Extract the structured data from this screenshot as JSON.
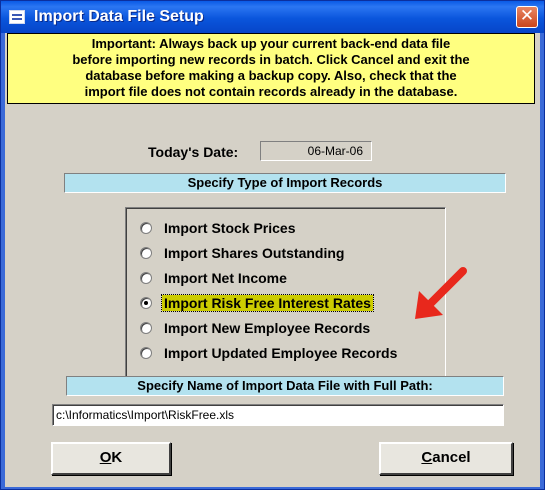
{
  "window": {
    "title": "Import Data File Setup",
    "close_glyph": "✕"
  },
  "warning": {
    "lines": [
      "Important: Always back up your current back-end data file",
      "before importing new records in batch. Click Cancel and exit the",
      "database before making a backup copy. Also, check that the",
      "import file does not contain records already in the database."
    ]
  },
  "date": {
    "label": "Today's Date:",
    "value": "06-Mar-06"
  },
  "import_type": {
    "header": "Specify Type of Import Records",
    "options": [
      {
        "label": "Import Stock Prices",
        "checked": false
      },
      {
        "label": "Import Shares Outstanding",
        "checked": false
      },
      {
        "label": "Import Net Income",
        "checked": false
      },
      {
        "label": "Import Risk Free Interest Rates",
        "checked": true
      },
      {
        "label": "Import New Employee Records",
        "checked": false
      },
      {
        "label": "Import Updated Employee Records",
        "checked": false
      }
    ]
  },
  "file": {
    "header": "Specify Name of Import Data File with Full Path:",
    "path": "c:\\Informatics\\Import\\RiskFree.xls"
  },
  "buttons": {
    "ok_mnemonic": "O",
    "ok_rest": "K",
    "cancel_mnemonic": "C",
    "cancel_rest": "ancel"
  },
  "colors": {
    "title_bar": "#0a55dc",
    "warning_bg": "#ffff80",
    "section_header_bg": "#b3e2ef",
    "selected_highlight": "#cccc00",
    "arrow": "#e8281c"
  },
  "icons": {
    "window": "form-icon",
    "close": "close-icon",
    "annotation": "red-arrow-icon"
  }
}
